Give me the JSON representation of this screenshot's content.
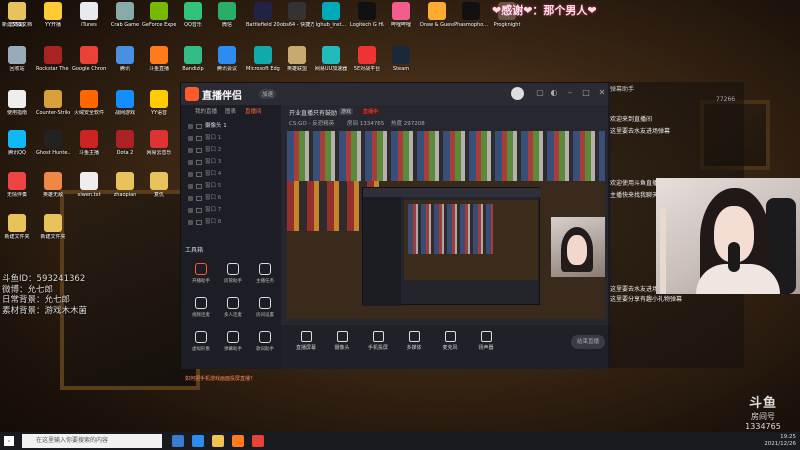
{
  "overlay": {
    "thanks_banner": "❤感谢❤：那个男人❤",
    "streamer_info": [
      "斗鱼ID：593241362",
      "微博：允七郎",
      "日常背景：允七郎",
      "素材背景：游戏木木菌"
    ]
  },
  "desktop_icons": [
    {
      "label": "此电脑",
      "color": "#3a7bd5"
    },
    {
      "label": "YY开播",
      "color": "#ffcc33"
    },
    {
      "label": "iTunes",
      "color": "#e9e9f0"
    },
    {
      "label": "Crab Game",
      "color": "#8aa"
    },
    {
      "label": "GeForce Experience",
      "color": "#76b900"
    },
    {
      "label": "QQ音乐",
      "color": "#31c27c"
    },
    {
      "label": "微信",
      "color": "#2aae67"
    },
    {
      "label": "Battlefield 2042 Ope...",
      "color": "#224"
    },
    {
      "label": "obs64 - 快捷方式",
      "color": "#333"
    },
    {
      "label": "lghub_inst...",
      "color": "#0ab"
    },
    {
      "label": "Logitech G HUB",
      "color": "#111"
    },
    {
      "label": "哔哩哔哩",
      "color": "#f25d8e"
    },
    {
      "label": "Draw & Guess",
      "color": "#fa3"
    },
    {
      "label": "Phasmopho...",
      "color": "#111"
    },
    {
      "label": "Progknight",
      "color": "#654"
    },
    {
      "label": "回收站",
      "color": "#9ab"
    },
    {
      "label": "Rockstar The Wire Sour...",
      "color": "#a22"
    },
    {
      "label": "Google Chrome",
      "color": "#ea4335"
    },
    {
      "label": "腾讯",
      "color": "#4a90e2"
    },
    {
      "label": "斗鱼直播",
      "color": "#ff7a1a"
    },
    {
      "label": "Bandizip",
      "color": "#3b8"
    },
    {
      "label": "腾讯会议",
      "color": "#2d8cf0"
    },
    {
      "label": "Microsoft Edge",
      "color": "#1aa"
    },
    {
      "label": "英雄联盟",
      "color": "#c8aa6e"
    },
    {
      "label": "网易UU加速器",
      "color": "#2bb"
    },
    {
      "label": "5E对战平台",
      "color": "#e33"
    },
    {
      "label": "Steam",
      "color": "#1b2838"
    },
    {
      "label": "使用指南",
      "color": "#eee"
    },
    {
      "label": "Counter-Strike: Global Off...",
      "color": "#d8a03a"
    },
    {
      "label": "火绒安全软件",
      "color": "#f60"
    },
    {
      "label": "战网游戏",
      "color": "#148eff"
    },
    {
      "label": "YY语音",
      "color": "#fc0"
    },
    {
      "label": "腾讯QQ",
      "color": "#12b7f5"
    },
    {
      "label": "Ghost Hunte...",
      "color": "#222"
    },
    {
      "label": "斗鱼主播",
      "color": "#c22"
    },
    {
      "label": "Dota 2",
      "color": "#a22"
    },
    {
      "label": "网易云音乐",
      "color": "#d33"
    },
    {
      "label": "无情伴奏",
      "color": "#e44"
    },
    {
      "label": "英雄无敌",
      "color": "#e84"
    },
    {
      "label": "xiwen.txt",
      "color": "#eee"
    },
    {
      "label": "zhaopian",
      "color": "#e8c25a"
    },
    {
      "label": "复仇",
      "color": "#e8c25a"
    },
    {
      "label": "新建文件夹",
      "color": "#e8c25a"
    },
    {
      "label": "新建文件夹",
      "color": "#e8c25a"
    },
    {
      "label": "新建文本文档",
      "color": "#fff"
    },
    {
      "label": "551",
      "color": "#e8c25a"
    }
  ],
  "app": {
    "brand": "直播伴侣",
    "version": "加速",
    "sidebar_tabs": [
      "我的直播",
      "图表",
      "直播间"
    ],
    "scenes": [
      "摄像头 1",
      "窗口 1",
      "窗口 2",
      "窗口 3",
      "窗口 4",
      "窗口 5",
      "窗口 6",
      "窗口 7",
      "窗口 8"
    ],
    "tools_title": "工具箱",
    "tools": [
      {
        "label": "开播助手",
        "color": "#ff5a2a"
      },
      {
        "label": "房管助手",
        "color": "#ddd"
      },
      {
        "label": "主播任务",
        "color": "#ddd"
      },
      {
        "label": "视频连麦",
        "color": "#ddd"
      },
      {
        "label": "多人连麦",
        "color": "#ddd"
      },
      {
        "label": "房间设置",
        "color": "#ddd"
      },
      {
        "label": "虚拟形象",
        "color": "#ddd"
      },
      {
        "label": "弹幕助手",
        "color": "#ddd"
      },
      {
        "label": "歌词助手",
        "color": "#ddd"
      }
    ],
    "notice": "如何把手机游戏画面投屏直播？",
    "main_title": "开业直播只有鼓励",
    "main_tag1": "游戏",
    "main_tag2": "直播中",
    "live_stats": [
      "CS:GO - 反恐精英",
      "房间 1334765",
      "热度 297208"
    ],
    "bottom_buttons": [
      "直播屏幕",
      "摄像头",
      "手机投屏",
      "多媒体",
      "麦克风",
      "扬声器"
    ],
    "go_live": "结束直播"
  },
  "chat": {
    "header": "弹幕助手",
    "messages": [
      "欢迎来到直播间",
      "这里要去水友进场弹幕",
      "欢迎使用斗鱼直播伴侣",
      "主播快来找我聊天吧",
      "这里要去水友进场弹幕",
      "这里要分享有趣小礼物弹幕"
    ],
    "online_count": "77266"
  },
  "room": {
    "platform_logo": "斗鱼",
    "room_label": "房间号",
    "room_id": "1334765"
  },
  "taskbar": {
    "search_placeholder": "在这里输入你要搜索的内容",
    "time": "19:25",
    "date": "2021/12/26",
    "app_icons": [
      "#3a7bd5",
      "#2d8cf0",
      "#f2c14e",
      "#ff7a1a",
      "#ea4335"
    ]
  }
}
